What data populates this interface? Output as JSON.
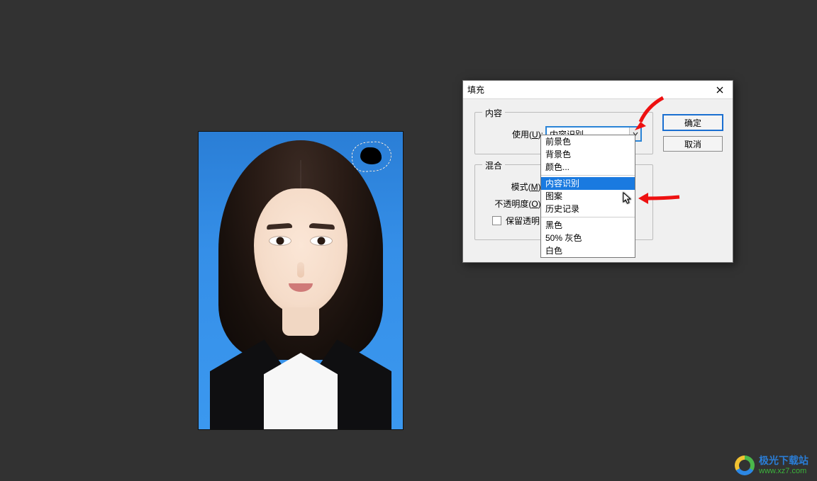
{
  "dialog": {
    "title": "填充",
    "close_label": "关闭",
    "content_legend": "内容",
    "blend_legend": "混合",
    "use_label_pre": "使用(",
    "use_label_u": "U",
    "use_label_post": "):",
    "use_value": "内容识别",
    "mode_label_pre": "模式(",
    "mode_label_u": "M",
    "mode_label_post": "):",
    "mode_value": "",
    "opacity_label_pre": "不透明度(",
    "opacity_label_u": "O",
    "opacity_label_post": "):",
    "opacity_value": "",
    "opacity_unit": "%",
    "preserve_label": "保留透明区域",
    "ok": "确定",
    "cancel": "取消"
  },
  "dropdown": {
    "options": [
      {
        "label": "前景色"
      },
      {
        "label": "背景色"
      },
      {
        "label": "颜色..."
      },
      {
        "sep": true
      },
      {
        "label": "内容识别",
        "selected": true
      },
      {
        "label": "图案"
      },
      {
        "label": "历史记录"
      },
      {
        "sep": true
      },
      {
        "label": "黑色"
      },
      {
        "label": "50% 灰色"
      },
      {
        "label": "白色"
      }
    ]
  },
  "watermark": {
    "line1": "极光下载站",
    "line2": "www.xz7.com"
  }
}
